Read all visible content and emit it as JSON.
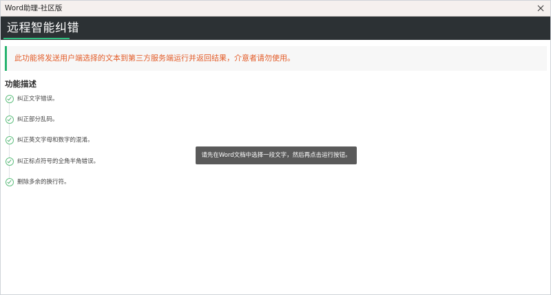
{
  "window": {
    "title": "Word助理-社区版",
    "close_icon": "close-icon"
  },
  "header": {
    "title": "远程智能纠错",
    "accent_color": "#2fbf80",
    "background_color": "#2c3134"
  },
  "notice": {
    "text": "此功能将发送用户端选择的文本到第三方服务端运行并返回结果，介意者请勿使用。",
    "text_color": "#e35d2a",
    "border_color": "#27b36f"
  },
  "features": {
    "title": "功能描述",
    "icon": "check-circle-icon",
    "items": [
      {
        "label": "纠正文字错误。"
      },
      {
        "label": "纠正部分乱码。"
      },
      {
        "label": "纠正英文字母和数字的混淆。"
      },
      {
        "label": "纠正标点符号的全角半角错误。"
      },
      {
        "label": "删除多余的换行符。"
      }
    ]
  },
  "toast": {
    "text": "请先在Word文档中选择一段文字，然后再点击运行按钮。"
  }
}
